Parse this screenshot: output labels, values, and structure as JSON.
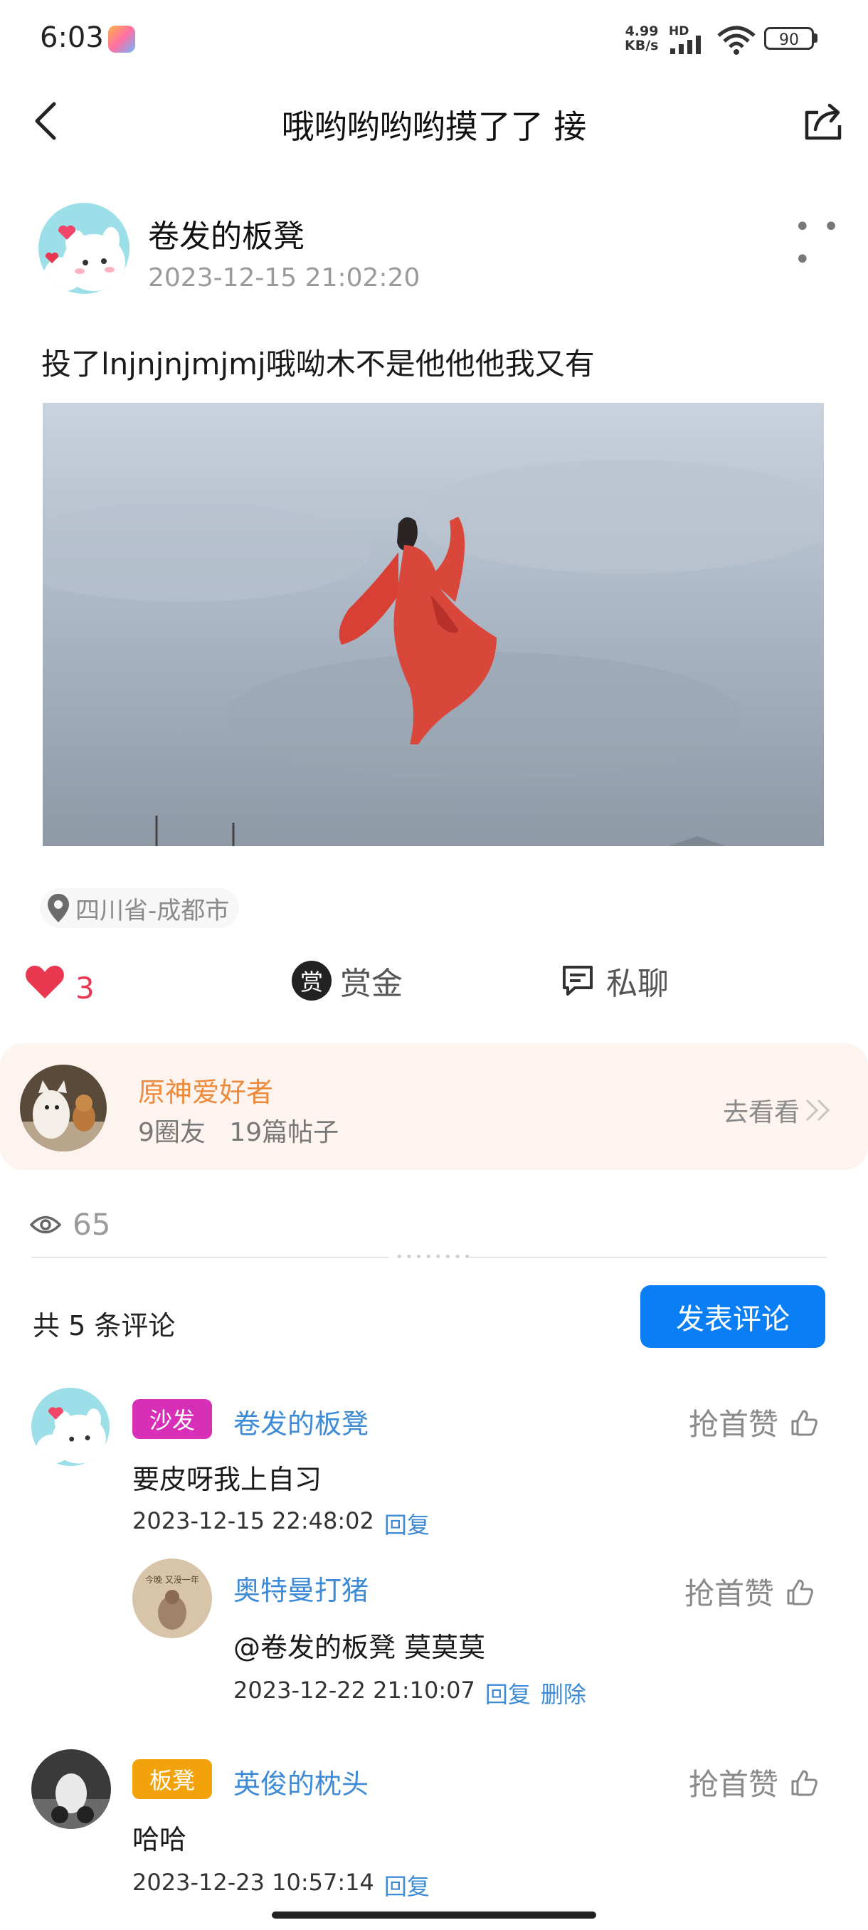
{
  "status": {
    "time": "6:03",
    "net_speed_value": "4.99",
    "net_speed_unit": "KB/s",
    "network_badge": "HD",
    "battery": "90"
  },
  "header": {
    "title": "哦哟哟哟哟摸了了 接"
  },
  "post": {
    "author": "卷发的板凳",
    "time": "2023-12-15 21:02:20",
    "text": "投了lnjnjnjmjmj哦呦木不是他他他我又有",
    "location": "四川省-成都市",
    "likes": "3",
    "tip_badge": "赏",
    "tip_label": "赏金",
    "chat_label": "私聊",
    "views": "65"
  },
  "circle": {
    "name": "原神爱好者",
    "members": "9圈友",
    "posts": "19篇帖子",
    "go_label": "去看看"
  },
  "comments_section": {
    "count_label": "共 5 条评论",
    "post_button": "发表评论"
  },
  "comments": [
    {
      "badge": "沙发",
      "name": "卷发的板凳",
      "text": "要皮呀我上自习",
      "time": "2023-12-15 22:48:02",
      "reply": "回复",
      "like": "抢首赞"
    },
    {
      "name": "奥特曼打猪",
      "text": "@卷发的板凳 莫莫莫",
      "time": "2023-12-22 21:10:07",
      "reply": "回复",
      "delete": "删除",
      "like": "抢首赞",
      "avatar_text": "今晚 又没一年"
    },
    {
      "badge": "板凳",
      "name": "英俊的枕头",
      "text": "哈哈",
      "time": "2023-12-23 10:57:14",
      "reply": "回复",
      "like": "抢首赞"
    }
  ],
  "colors": {
    "accent_blue": "#0a7ef5",
    "like_red": "#e8374f",
    "sofa_badge": "#d72fb8",
    "bench_badge": "#f2a20a",
    "circle_name": "#ee8a3c",
    "link_blue": "#3d8ad6"
  },
  "icons": [
    "back-icon",
    "share-icon",
    "more-icon",
    "location-icon",
    "heart-icon",
    "chat-icon",
    "eye-icon",
    "thumb-up-icon",
    "chevron-double-right-icon",
    "signal-icon",
    "wifi-icon",
    "battery-icon"
  ]
}
